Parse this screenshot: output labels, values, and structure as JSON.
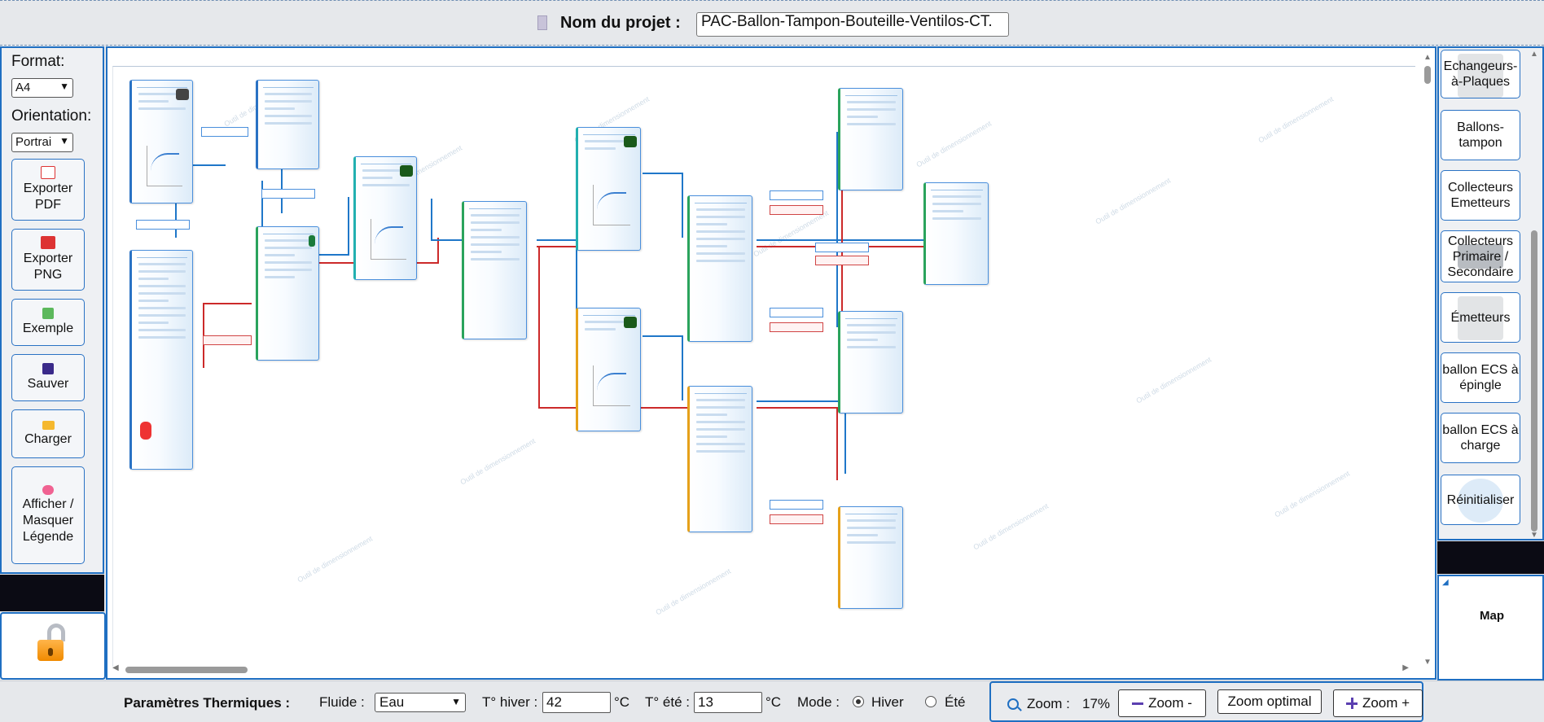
{
  "header": {
    "project_label": "Nom du projet :",
    "project_name": "PAC-Ballon-Tampon-Bouteille-Ventilos-CT."
  },
  "left_toolbar": {
    "format_label": "Format:",
    "format_value": "A4",
    "orientation_label": "Orientation:",
    "orientation_value": "Portrai",
    "buttons": [
      {
        "label": "Exporter PDF",
        "icon": "pdf-icon"
      },
      {
        "label": "Exporter PNG",
        "icon": "png-icon"
      },
      {
        "label": "Exemple",
        "icon": "puzzle-icon"
      },
      {
        "label": "Sauver",
        "icon": "floppy-disk-icon"
      },
      {
        "label": "Charger",
        "icon": "folder-icon"
      },
      {
        "label": "Afficher / Masquer Légende",
        "icon": "brain-icon"
      }
    ],
    "lock_icon": "unlocked-padlock-icon"
  },
  "component_palette": {
    "items": [
      "Echangeurs-à-Plaques",
      "Ballons-tampon",
      "Collecteurs Emetteurs",
      "Collecteurs Primaire / Secondaire",
      "Émetteurs",
      "ballon ECS à épingle",
      "ballon ECS à charge",
      "Réinitialiser"
    ]
  },
  "map": {
    "label": "Map"
  },
  "thermal_params": {
    "title": "Paramètres Thermiques :",
    "fluid_label": "Fluide :",
    "fluid_value": "Eau",
    "t_winter_label": "T° hiver :",
    "t_winter_value": "42",
    "t_winter_unit": "°C",
    "t_summer_label": "T° été :",
    "t_summer_value": "13",
    "t_summer_unit": "°C",
    "mode_label": "Mode :",
    "mode_winter": "Hiver",
    "mode_summer": "Été",
    "mode_selected": "Hiver"
  },
  "zoom": {
    "label": "Zoom :",
    "value": "17%",
    "zoom_out_label": "Zoom -",
    "optimal_label": "Zoom optimal",
    "zoom_in_label": "Zoom +"
  },
  "colors": {
    "accent": "#1f6fc2",
    "supply_pipe": "#1f77c9",
    "return_pipe": "#cc2a2a"
  }
}
